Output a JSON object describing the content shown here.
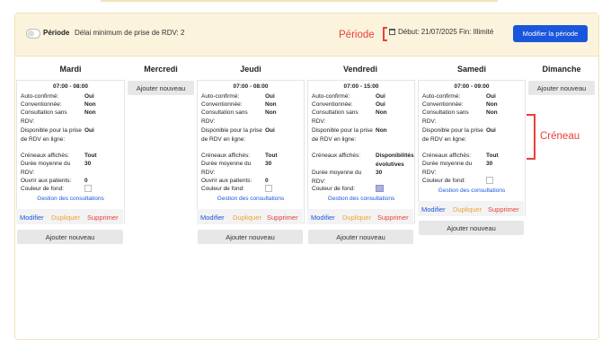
{
  "header": {
    "periode_label": "Période",
    "delai": "Délai minimum de prise de RDV: 2",
    "debut_fin": "Début: 21/07/2025 Fin: Illimité",
    "modify_button": "Modifier la période"
  },
  "annotations": {
    "periode": "Période",
    "creneau": "Créneau"
  },
  "days": [
    "Mardi",
    "Mercredi",
    "Jeudi",
    "Vendredi",
    "Samedi",
    "Dimanche"
  ],
  "labels": {
    "add_new": "Ajouter nouveau",
    "gestion": "Gestion des consultations",
    "modifier": "Modifier",
    "dupliquer": "Dupliquer",
    "supprimer": "Supprimer"
  },
  "slots": {
    "mardi": {
      "time": "07:00 - 08:00",
      "rows": [
        {
          "k": "Auto-confirmé:",
          "v": "Oui"
        },
        {
          "k": "Conventionnée:",
          "v": "Non"
        },
        {
          "k": "Consultation sans RDV:",
          "v": "Non"
        },
        {
          "k": "Disponible pour la prise de RDV en ligne:",
          "v": "Oui"
        },
        {
          "k": "Créneaux affichés:",
          "v": "Tout"
        },
        {
          "k": "Durée moyenne du RDV:",
          "v": "30"
        },
        {
          "k": "Ouvrir aux patients:",
          "v": "0"
        },
        {
          "k": "Couleur de fond:",
          "v": ""
        }
      ]
    },
    "jeudi": {
      "time": "07:00 - 08:00",
      "rows": [
        {
          "k": "Auto-confirmé:",
          "v": "Oui"
        },
        {
          "k": "Conventionnée:",
          "v": "Non"
        },
        {
          "k": "Consultation sans RDV:",
          "v": "Non"
        },
        {
          "k": "Disponible pour la prise de RDV en ligne:",
          "v": "Oui"
        },
        {
          "k": "Créneaux affichés:",
          "v": "Tout"
        },
        {
          "k": "Durée moyenne du RDV:",
          "v": "30"
        },
        {
          "k": "Ouvrir aux patients:",
          "v": "0"
        },
        {
          "k": "Couleur de fond:",
          "v": ""
        }
      ]
    },
    "vendredi": {
      "time": "07:00 - 15:00",
      "rows": [
        {
          "k": "Auto-confirmé:",
          "v": "Oui"
        },
        {
          "k": "Conventionnée:",
          "v": "Oui"
        },
        {
          "k": "Consultation sans RDV:",
          "v": "Non"
        },
        {
          "k": "Disponible pour la prise de RDV en ligne:",
          "v": "Non"
        },
        {
          "k": "Créneaux affichés:",
          "v": "Disponibilités évolutives"
        },
        {
          "k": "Durée moyenne du RDV:",
          "v": "30"
        },
        {
          "k": "Couleur de fond:",
          "v": ""
        }
      ]
    },
    "samedi": {
      "time": "07:00 - 09:00",
      "rows": [
        {
          "k": "Auto-confirmé:",
          "v": "Oui"
        },
        {
          "k": "Conventionnée:",
          "v": "Non"
        },
        {
          "k": "Consultation sans RDV:",
          "v": "Non"
        },
        {
          "k": "Disponible pour la prise de RDV en ligne:",
          "v": "Oui"
        },
        {
          "k": "Créneaux affichés:",
          "v": "Tout"
        },
        {
          "k": "Durée moyenne du RDV:",
          "v": "30"
        },
        {
          "k": "Couleur de fond:",
          "v": ""
        }
      ]
    }
  },
  "colors": {
    "primary": "#1a56db",
    "annotation_red": "#e8403a",
    "dupliquer_orange": "#f0a133",
    "header_bg": "#fbf3dc",
    "vendredi_swatch": "#aab0dd"
  }
}
